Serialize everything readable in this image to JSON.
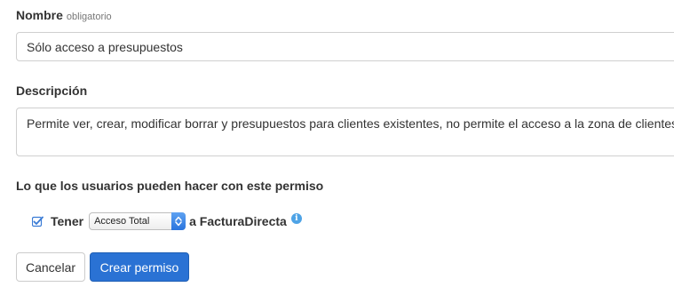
{
  "form": {
    "name_label": "Nombre",
    "name_hint": "obligatorio",
    "name_value": "Sólo acceso a presupuestos",
    "description_label": "Descripción",
    "description_value": "Permite ver, crear, modificar borrar y presupuestos para clientes existentes, no permite el acceso a la zona de clientes.",
    "permissions_heading": "Lo que los usuarios pueden hacer con este permiso"
  },
  "permission_row": {
    "checked": true,
    "prefix": "Tener",
    "access_selected": "Acceso Total",
    "suffix": "a FacturaDirecta",
    "info_glyph": "i",
    "info_icon": "info-icon"
  },
  "buttons": {
    "cancel_label": "Cancelar",
    "create_label": "Crear permiso"
  },
  "colors": {
    "primary": "#2a72d4",
    "info": "#4ea3e6",
    "check": "#3a7bd5"
  }
}
